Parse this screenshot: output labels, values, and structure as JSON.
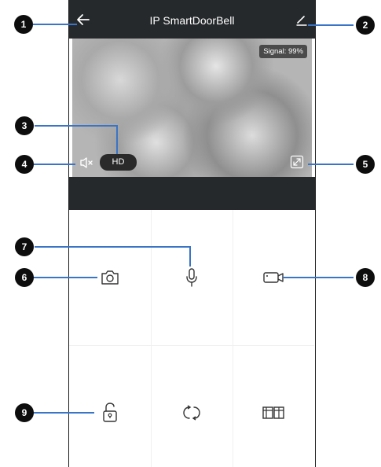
{
  "app": {
    "title": "IP SmartDoorBell",
    "signal_text": "Signal: 99%",
    "hd_label": "HD"
  },
  "icons": {
    "back": "arrow-left-icon",
    "edit": "pencil-icon",
    "mute": "speaker-mute-icon",
    "fullscreen": "fullscreen-icon",
    "snapshot": "camera-icon",
    "talk": "microphone-icon",
    "record": "video-camera-icon",
    "unlock": "unlock-icon",
    "rotate": "rotate-icon",
    "gallery": "gallery-icon"
  },
  "callouts": [
    "1",
    "2",
    "3",
    "4",
    "5",
    "6",
    "7",
    "8",
    "9"
  ],
  "colors": {
    "topbar": "#26292c",
    "callout": "#0d0d0d",
    "leader": "#3a74c6"
  }
}
